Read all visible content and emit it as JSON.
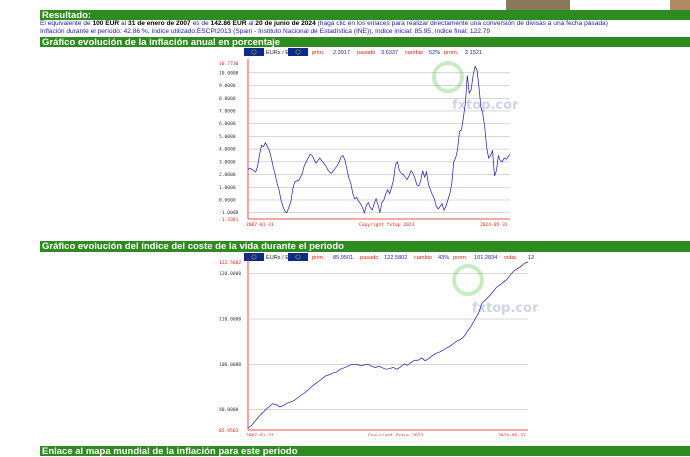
{
  "result": {
    "title": "Resultado:",
    "line1_pre": "El equivalente de",
    "line1_amount_start": "100 EUR",
    "line1_mid": "al",
    "line1_date_start": "31 de enero de 2007",
    "line1_es": "es de",
    "line1_amount_end": "142.86 EUR",
    "line1_mid2": "al",
    "line1_date_end": "20 de junio de 2024",
    "line1_link": "(haga clic en los enlaces para realizar directamente una conversión de divisas a una fecha pasada)",
    "line2": "Inflación durante el período: 42.86 %, índice utilizado:ESCPI2013 (Spain - Instituto Nacional de Estadística (INE)), índice inicial: 85.95, índice final: 122.79"
  },
  "chart1": {
    "section_title": "Gráfico evolución de la inflación anual en porcentaje",
    "legend": "EURs / EUR",
    "stats": {
      "prim_label": "prim.",
      "prim_value": "2.3917",
      "pasado_label": "pasado",
      "pasado_value": "3.6337",
      "cambio_label": "cambio",
      "cambio_value": "52%",
      "prom_label": "prom.",
      "prom_value": "2.1521"
    },
    "watermark": "fxtop.com",
    "copyright": "Copyright fxtop 2023",
    "x_start": "2007-01-31",
    "x_end": "2024-05-31",
    "chart_data": {
      "type": "line",
      "y_ticks": [
        "10.0000",
        "9.0000",
        "8.0000",
        "7.0000",
        "6.0000",
        "5.0000",
        "4.0000",
        "3.0000",
        "2.0000",
        "1.0000",
        "0.0000",
        "-1.0000"
      ],
      "ymax_label": "10.7730",
      "ymin_label": "-1.3381",
      "ylim": [
        -1.3381,
        10.773
      ],
      "x_range": [
        "2007-01-31",
        "2024-05-31"
      ],
      "series": [
        {
          "values": [
            2.4,
            2.5,
            2.4,
            2.3,
            2.2,
            2.7,
            3.6,
            4.3,
            4.2,
            4.5,
            4.2,
            3.9,
            3.3,
            2.6,
            2.0,
            1.3,
            0.8,
            0.0,
            -0.5,
            -0.9,
            -1.0,
            -0.6,
            -0.2,
            0.8,
            1.4,
            1.5,
            1.5,
            1.8,
            2.1,
            2.7,
            3.0,
            3.3,
            3.6,
            3.5,
            3.2,
            2.9,
            3.1,
            3.3,
            3.1,
            2.9,
            2.7,
            2.4,
            2.2,
            2.1,
            2.3,
            2.5,
            2.7,
            3.0,
            3.4,
            3.5,
            3.1,
            2.4,
            1.7,
            1.3,
            0.5,
            0.1,
            0.2,
            -0.1,
            -0.3,
            -0.6,
            -1.0,
            -0.4,
            -0.2,
            -0.6,
            -0.8,
            -0.3,
            0.1,
            -0.4,
            -1.0,
            -0.2,
            0.0,
            0.5,
            0.8,
            0.5,
            1.0,
            1.6,
            2.8,
            3.0,
            2.3,
            2.1,
            2.0,
            1.8,
            1.6,
            1.9,
            2.3,
            2.1,
            1.7,
            1.2,
            1.1,
            1.5,
            2.3,
            1.8,
            2.2,
            1.2,
            0.8,
            0.4,
            0.1,
            -0.5,
            -0.7,
            -0.5,
            -0.3,
            -0.8,
            -0.5,
            0.0,
            0.5,
            1.3,
            3.0,
            3.3,
            4.0,
            5.4,
            5.5,
            6.5,
            7.6,
            9.8,
            8.4,
            8.7,
            9.8,
            10.5,
            10.2,
            8.9,
            7.3,
            6.8,
            5.7,
            4.1,
            3.3,
            3.5,
            3.9,
            1.9,
            2.3,
            3.5,
            3.1,
            3.0,
            3.3,
            3.2,
            3.4,
            3.6
          ]
        }
      ]
    }
  },
  "chart2": {
    "section_title": "Gráfico evolución del índice del coste de la vida durante el periodo",
    "legend": "EURs / EUR",
    "stats": {
      "prim_label": "prim.",
      "prim_value": "85.9501",
      "pasado_label": "pasado",
      "pasado_value": "122.5802",
      "cambio_label": "cambio",
      "cambio_value": "43%",
      "prom_label": "prom.",
      "prom_value": "101.2834",
      "volat_label": "volat.",
      "volat_value": "12"
    },
    "watermark": "fxtop.com",
    "copyright": "Copyright fxtop 2023",
    "x_start": "2007-01-31",
    "x_end": "2024-05-31",
    "chart_data": {
      "type": "line",
      "y_ticks": [
        "120.0000",
        "110.0000",
        "100.0000",
        "90.0000"
      ],
      "ymax_label": "122.5802",
      "ymin_label": "85.9501",
      "ylim": [
        85.9501,
        122.5802
      ],
      "x_range": [
        "2007-01-31",
        "2024-05-31"
      ],
      "series": [
        {
          "values": [
            85.95,
            86.5,
            87.5,
            88.4,
            89.2,
            90.0,
            90.7,
            91.3,
            91.1,
            90.6,
            90.9,
            91.4,
            91.7,
            92.0,
            92.6,
            93.2,
            93.7,
            94.4,
            95.1,
            95.7,
            96.3,
            96.9,
            97.5,
            97.7,
            98.1,
            98.3,
            98.9,
            99.2,
            99.5,
            99.9,
            100.0,
            99.9,
            99.7,
            99.9,
            100.0,
            99.5,
            99.3,
            99.6,
            99.2,
            98.9,
            99.1,
            99.3,
            98.9,
            99.4,
            100.1,
            99.8,
            100.4,
            100.9,
            100.9,
            101.4,
            100.8,
            101.3,
            101.9,
            102.4,
            102.7,
            103.1,
            103.6,
            104.0,
            104.6,
            105.2,
            105.5,
            106.2,
            107.4,
            108.5,
            109.9,
            111.2,
            113.5,
            114.2,
            115.0,
            115.9,
            116.9,
            117.5,
            118.1,
            118.7,
            119.7,
            120.6,
            121.1,
            121.6,
            122.3,
            122.58
          ]
        }
      ]
    }
  },
  "footer_bar": "Enlace al mapa mundial de la inflación para este periodo"
}
